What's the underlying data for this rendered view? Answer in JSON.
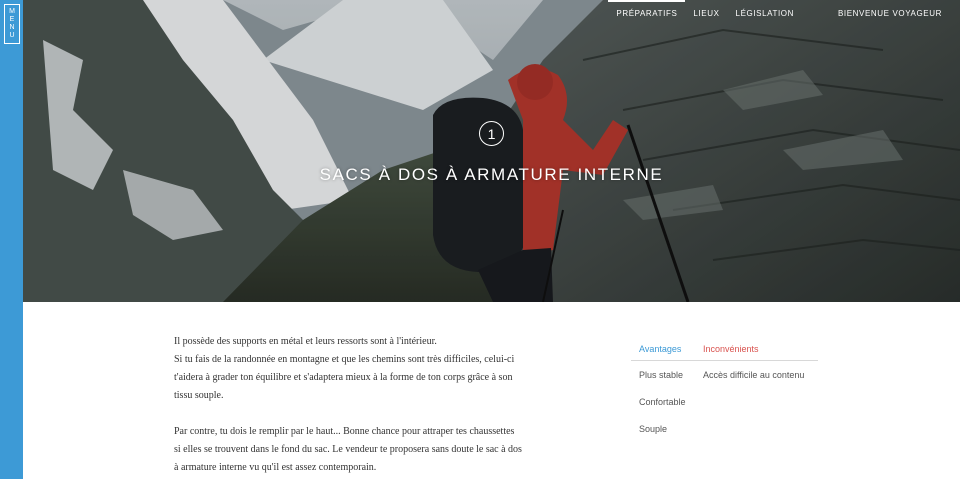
{
  "menu": {
    "letters": [
      "M",
      "E",
      "N",
      "U"
    ]
  },
  "nav": {
    "items": [
      {
        "label": "Préparatifs",
        "active": true
      },
      {
        "label": "Lieux",
        "active": false
      },
      {
        "label": "Législation",
        "active": false
      }
    ],
    "greeting": "Bienvenue voyageur"
  },
  "hero": {
    "step_number": "1",
    "title": "Sacs à dos à armature interne"
  },
  "content": {
    "paragraph1": [
      "Il possède des supports en métal et leurs ressorts sont à l'intérieur.",
      "Si tu fais de la randonnée en montagne et que les chemins sont très difficiles, celui-ci",
      "t'aidera à grader ton équilibre et s'adaptera mieux à la forme de ton corps grâce à son",
      "tissu souple."
    ],
    "paragraph2": [
      "Par contre, tu dois le remplir par le haut... Bonne chance pour attraper tes chaussettes",
      "si elles se trouvent dans le fond du sac. Le vendeur te proposera sans doute le sac à dos",
      "à armature interne vu qu'il est assez contemporain."
    ]
  },
  "compare": {
    "header_advantages": "Avantages",
    "header_disadvantages": "Inconvénients",
    "rows": [
      {
        "advantage": "Plus stable",
        "disadvantage": "Accès difficile au contenu"
      },
      {
        "advantage": "Confortable",
        "disadvantage": ""
      },
      {
        "advantage": "Souple",
        "disadvantage": ""
      }
    ]
  },
  "colors": {
    "accent": "#3d9ad6",
    "disadvantage": "#d9534f"
  }
}
